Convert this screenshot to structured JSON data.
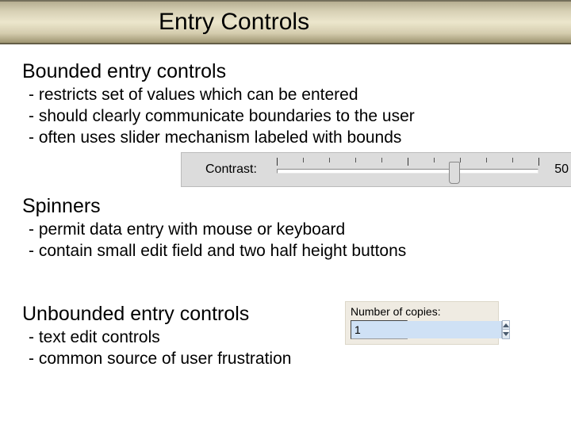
{
  "title": "Entry Controls",
  "sections": {
    "bounded": {
      "heading": "Bounded entry controls",
      "bullets": {
        "b0": "- restricts set of values which can be entered",
        "b1": "- should clearly communicate boundaries to the user",
        "b2": "- often uses slider mechanism labeled with bounds"
      }
    },
    "spinners": {
      "heading": "Spinners",
      "bullets": {
        "b0": "- permit data entry with mouse or keyboard",
        "b1": "- contain small edit field and two half height buttons"
      }
    },
    "unbounded": {
      "heading": "Unbounded entry controls",
      "bullets": {
        "b0": "- text edit controls",
        "b1": "- common source of user frustration"
      }
    }
  },
  "slider_widget": {
    "label": "Contrast:",
    "value_display": "50",
    "position_percent": 68
  },
  "spinner_widget": {
    "label": "Number of copies:",
    "value": "1"
  }
}
